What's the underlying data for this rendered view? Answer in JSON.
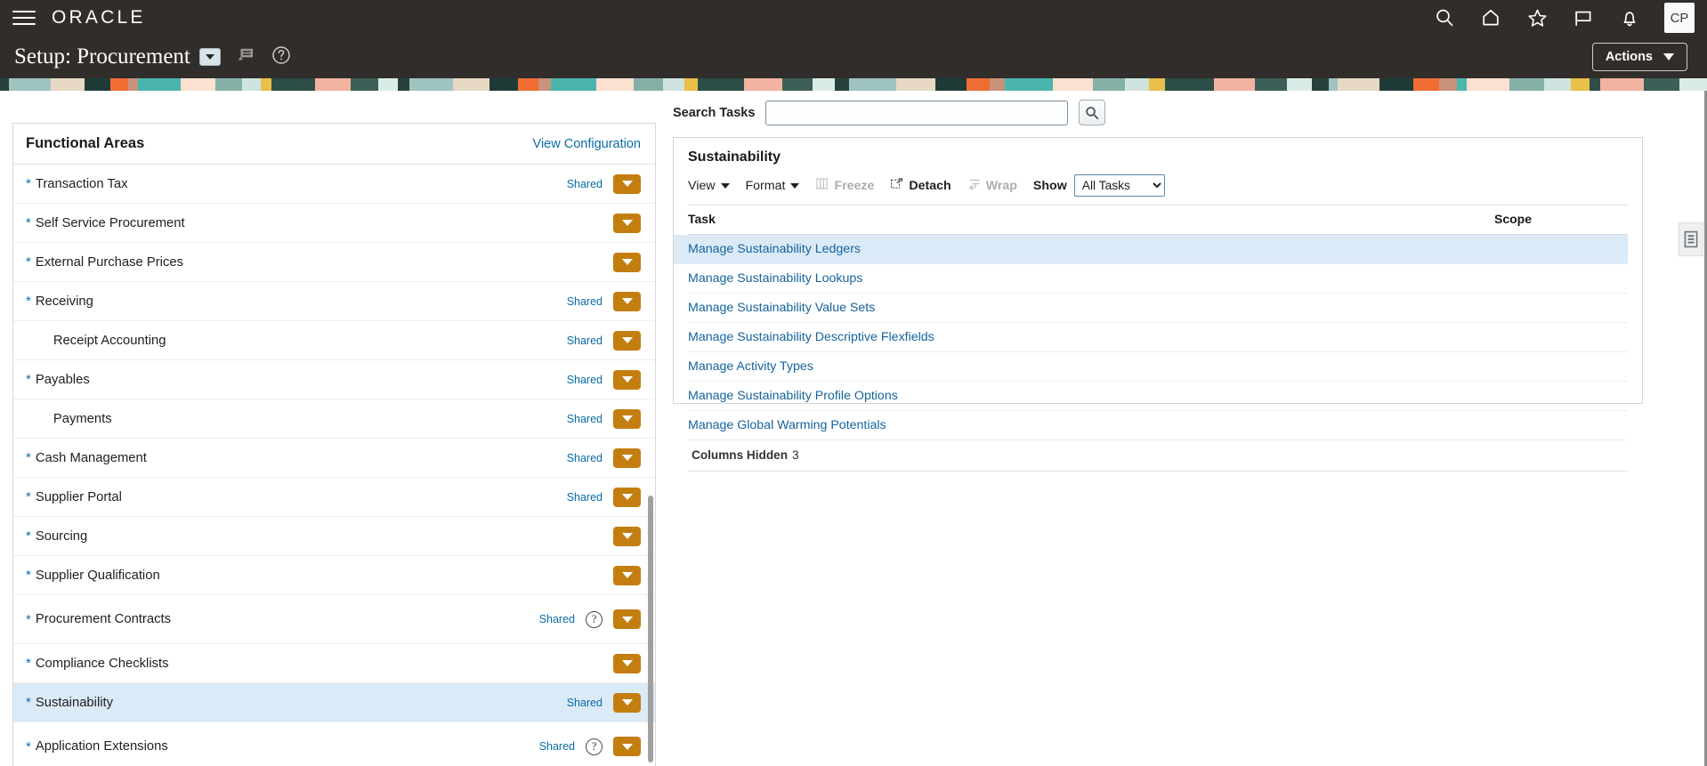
{
  "global_header": {
    "menu_icon": "hamburger-menu-icon",
    "brand": "ORACLE",
    "icons": [
      "search-icon",
      "home-icon",
      "favorites-star-icon",
      "flag-icon",
      "notifications-bell-icon"
    ],
    "avatar_initials": "CP"
  },
  "title_bar": {
    "title": "Setup: Procurement",
    "dropdown_icon": "chevron-down-icon",
    "announcement_icon": "announcement-icon",
    "help_icon": "help-circle-icon",
    "actions_label": "Actions"
  },
  "banner": {
    "colors": [
      "#27413c",
      "#9fc3bf",
      "#e7d8c4",
      "#1e3b38",
      "#ef6c33",
      "#c8937a",
      "#4ab5ad",
      "#fce0d0",
      "#84b0a8",
      "#cfe4e0",
      "#e8c04a",
      "#2e4e48",
      "#f2b3a0",
      "#3c5f58",
      "#d9ece8"
    ]
  },
  "functional_areas": {
    "panel_title": "Functional Areas",
    "view_configuration_label": "View Configuration",
    "required_marker": "*",
    "shared_label": "Shared",
    "help_icon": "help-circle-icon",
    "dropdown_icon": "chevron-down-icon",
    "items": [
      {
        "label": "Transaction Tax",
        "required": true,
        "indented": false,
        "shared": "Shared",
        "help": false,
        "selected": false
      },
      {
        "label": "Self Service Procurement",
        "required": true,
        "indented": false,
        "shared": "",
        "help": false,
        "selected": false
      },
      {
        "label": "External Purchase Prices",
        "required": true,
        "indented": false,
        "shared": "",
        "help": false,
        "selected": false
      },
      {
        "label": "Receiving",
        "required": true,
        "indented": false,
        "shared": "Shared",
        "help": false,
        "selected": false
      },
      {
        "label": "Receipt Accounting",
        "required": false,
        "indented": true,
        "shared": "Shared",
        "help": false,
        "selected": false
      },
      {
        "label": "Payables",
        "required": true,
        "indented": false,
        "shared": "Shared",
        "help": false,
        "selected": false
      },
      {
        "label": "Payments",
        "required": false,
        "indented": true,
        "shared": "Shared",
        "help": false,
        "selected": false
      },
      {
        "label": "Cash Management",
        "required": true,
        "indented": false,
        "shared": "Shared",
        "help": false,
        "selected": false
      },
      {
        "label": "Supplier Portal",
        "required": true,
        "indented": false,
        "shared": "Shared",
        "help": false,
        "selected": false
      },
      {
        "label": "Sourcing",
        "required": true,
        "indented": false,
        "shared": "",
        "help": false,
        "selected": false
      },
      {
        "label": "Supplier Qualification",
        "required": true,
        "indented": false,
        "shared": "",
        "help": false,
        "selected": false
      },
      {
        "label": "Procurement Contracts",
        "required": true,
        "indented": false,
        "shared": "Shared",
        "help": true,
        "selected": false
      },
      {
        "label": "Compliance Checklists",
        "required": true,
        "indented": false,
        "shared": "",
        "help": false,
        "selected": false
      },
      {
        "label": "Sustainability",
        "required": true,
        "indented": false,
        "shared": "Shared",
        "help": false,
        "selected": true
      },
      {
        "label": "Application Extensions",
        "required": true,
        "indented": false,
        "shared": "Shared",
        "help": true,
        "selected": false
      }
    ]
  },
  "search": {
    "label": "Search Tasks",
    "value": "",
    "placeholder": "",
    "button_icon": "search-icon"
  },
  "task_panel": {
    "title": "Sustainability",
    "toolbar": {
      "view_label": "View",
      "format_label": "Format",
      "freeze_label": "Freeze",
      "detach_label": "Detach",
      "wrap_label": "Wrap",
      "show_label": "Show",
      "show_value": "All Tasks",
      "show_options": [
        "All Tasks"
      ]
    },
    "columns": [
      "Task",
      "Scope"
    ],
    "rows": [
      {
        "task": "Manage Sustainability Ledgers",
        "scope": "",
        "selected": true
      },
      {
        "task": "Manage Sustainability Lookups",
        "scope": "",
        "selected": false
      },
      {
        "task": "Manage Sustainability Value Sets",
        "scope": "",
        "selected": false
      },
      {
        "task": "Manage Sustainability Descriptive Flexfields",
        "scope": "",
        "selected": false
      },
      {
        "task": "Manage Activity Types",
        "scope": "",
        "selected": false
      },
      {
        "task": "Manage Sustainability Profile Options",
        "scope": "",
        "selected": false
      },
      {
        "task": "Manage Global Warming Potentials",
        "scope": "",
        "selected": false
      }
    ],
    "footer_label": "Columns Hidden",
    "footer_count": "3"
  },
  "side_tab": {
    "icon": "document-list-icon"
  }
}
